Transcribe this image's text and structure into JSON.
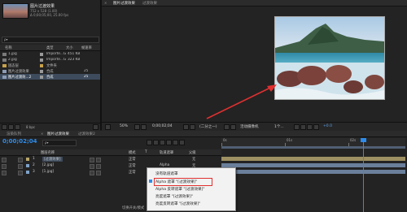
{
  "project": {
    "comp_name": "图片过渡效果",
    "comp_info": "752 x 528 (1.00)",
    "comp_info2": "Δ 0;00;05;00, 25.00 fps",
    "search_placeholder": "ρ▾",
    "columns": {
      "name": "名称",
      "type": "类型",
      "size": "大小",
      "frame_rate": "帧速率"
    },
    "items": [
      {
        "name": "1.jpg",
        "type": "Importe...G",
        "size": "451 KB",
        "icon": "image-icon",
        "swatch": "#9a9a9a"
      },
      {
        "name": "2.jpg",
        "type": "Importe...G",
        "size": "323 KB",
        "icon": "image-icon",
        "swatch": "#9a9a9a"
      },
      {
        "name": "固态层",
        "type": "文件夹",
        "size": "",
        "icon": "folder-icon",
        "swatch": "#c9a24a"
      },
      {
        "name": "图片过渡效果",
        "type": "合成",
        "size": "",
        "frame_rate": "25",
        "icon": "composition-icon",
        "swatch": "#9a9a9a"
      },
      {
        "name": "图片过渡效...2",
        "type": "合成",
        "size": "",
        "frame_rate": "25",
        "icon": "composition-icon",
        "swatch": "#9a9a9a"
      }
    ],
    "bpc": "8 bpc"
  },
  "viewer": {
    "tab_label": "图片过渡效果",
    "tab_label2": "过渡效果",
    "zoom": "50%",
    "timecode": "0;00;02;04",
    "resolution": "(二分之一)",
    "camera": "活动摄像机",
    "views": "1个...",
    "offset": "+0.0"
  },
  "timeline": {
    "tabs": [
      "渲染队列",
      "图片过渡效果",
      "过渡效果2"
    ],
    "current_time": "0;00;02;04",
    "frame_hint": "00054 (25.00 fps)",
    "search_placeholder": "ρ▾",
    "columns": {
      "source": "图层名称",
      "mode": "模式",
      "t": "T",
      "trkmat": "轨道遮罩",
      "parent": "父级"
    },
    "ruler": [
      "0s",
      "01s",
      "02s"
    ],
    "layers": [
      {
        "num": "1",
        "name": "[过渡效果]",
        "mode": "正常",
        "trkmat": "",
        "parent": "无",
        "color": "#b8a66a"
      },
      {
        "num": "2",
        "name": "[2.jpg]",
        "mode": "正常",
        "trkmat": "Alpha",
        "parent": "无",
        "color": "#7fa2c8"
      },
      {
        "num": "3",
        "name": "[1.jpg]",
        "mode": "正常",
        "trkmat": "无",
        "parent": "无",
        "color": "#7fa2c8"
      }
    ],
    "bottom_label": "切换开关/模式"
  },
  "context_menu": {
    "items": [
      {
        "label": "没有轨道遮罩",
        "selected": false
      },
      {
        "label": "Alpha 遮罩 \"[过渡效果]\"",
        "selected": true
      },
      {
        "label": "Alpha 反转遮罩 \"[过渡效果]\"",
        "selected": false
      },
      {
        "label": "亮度遮罩 \"[过渡效果]\"",
        "selected": false
      },
      {
        "label": "亮度反转遮罩 \"[过渡效果]\"",
        "selected": false
      }
    ]
  },
  "colors": {
    "accent_blue": "#2d8ceb",
    "annotation_red": "#e03030",
    "menu_bg": "#f2f2f2",
    "highlight_border": "#e03030"
  }
}
